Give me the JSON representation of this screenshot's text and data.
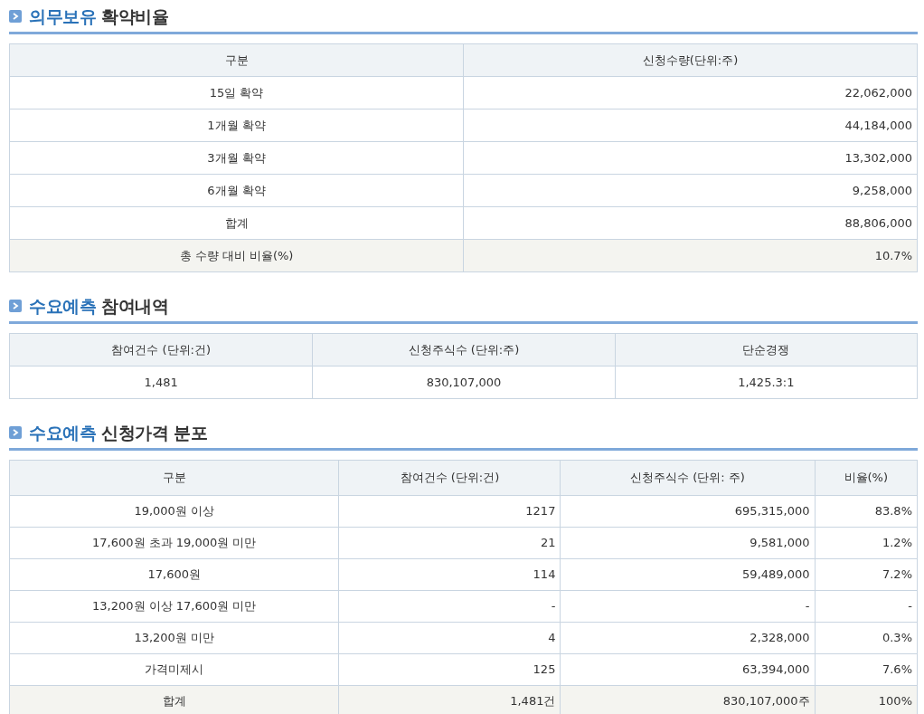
{
  "sections": [
    {
      "title": {
        "accent": "의무보유",
        "rest": "확약비율"
      },
      "columns": [
        "구분",
        "신청수량(단위:주)"
      ],
      "rows": [
        {
          "cells": [
            "15일 확약",
            "22,062,000"
          ],
          "shaded": false
        },
        {
          "cells": [
            "1개월 확약",
            "44,184,000"
          ],
          "shaded": false
        },
        {
          "cells": [
            "3개월 확약",
            "13,302,000"
          ],
          "shaded": false
        },
        {
          "cells": [
            "6개월 확약",
            "9,258,000"
          ],
          "shaded": false
        },
        {
          "cells": [
            "합계",
            "88,806,000"
          ],
          "shaded": false
        },
        {
          "cells": [
            "총 수량 대비 비율(%)",
            "10.7%"
          ],
          "shaded": true
        }
      ]
    },
    {
      "title": {
        "accent": "수요예측",
        "rest": "참여내역"
      },
      "columns": [
        "참여건수 (단위:건)",
        "신청주식수 (단위:주)",
        "단순경쟁"
      ],
      "rows": [
        {
          "cells": [
            "1,481",
            "830,107,000",
            "1,425.3:1"
          ],
          "shaded": false
        }
      ]
    },
    {
      "title": {
        "accent": "수요예측",
        "rest": "신청가격 분포"
      },
      "columns": [
        "구분",
        "참여건수 (단위:건)",
        "신청주식수 (단위: 주)",
        "비율(%)"
      ],
      "rows": [
        {
          "cells": [
            "19,000원 이상",
            "1217",
            "695,315,000",
            "83.8%"
          ],
          "shaded": false
        },
        {
          "cells": [
            "17,600원 초과 19,000원 미만",
            "21",
            "9,581,000",
            "1.2%"
          ],
          "shaded": false
        },
        {
          "cells": [
            "17,600원",
            "114",
            "59,489,000",
            "7.2%"
          ],
          "shaded": false
        },
        {
          "cells": [
            "13,200원 이상 17,600원 미만",
            "-",
            "-",
            "-"
          ],
          "shaded": false
        },
        {
          "cells": [
            "13,200원 미만",
            "4",
            "2,328,000",
            "0.3%"
          ],
          "shaded": false
        },
        {
          "cells": [
            "가격미제시",
            "125",
            "63,394,000",
            "7.6%"
          ],
          "shaded": false
        },
        {
          "cells": [
            "합계",
            "1,481건",
            "830,107,000주",
            "100%"
          ],
          "shaded": true
        }
      ]
    }
  ]
}
